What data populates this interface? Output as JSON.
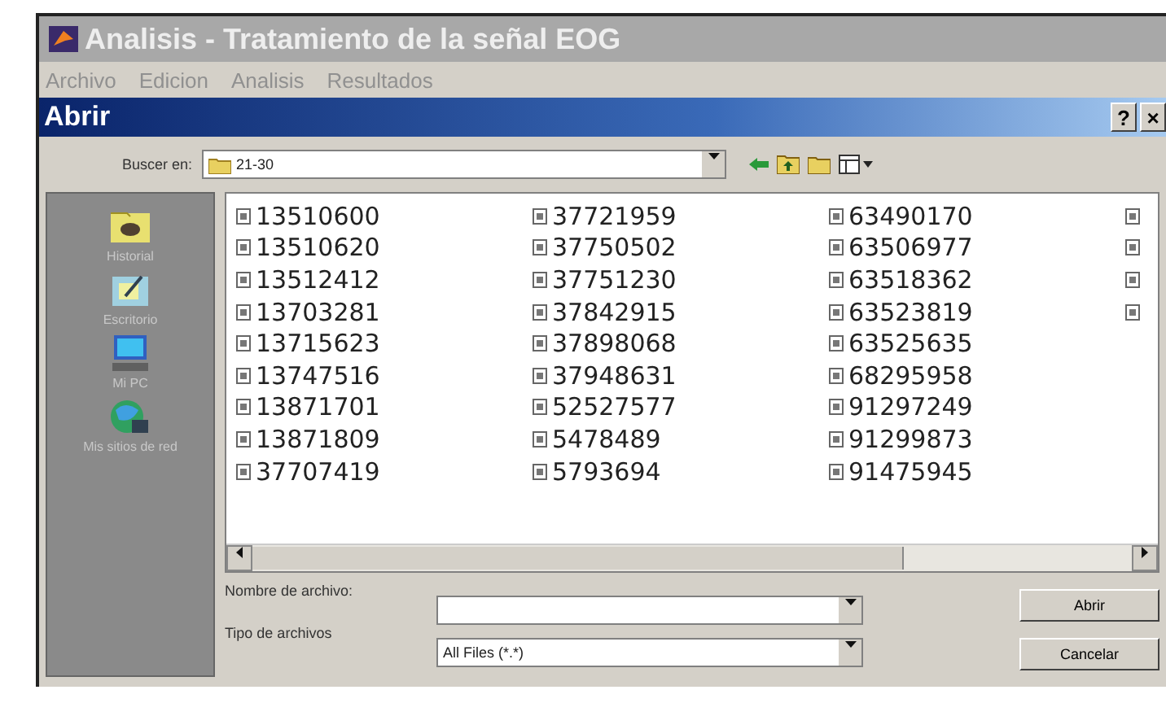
{
  "window": {
    "title": "Analisis - Tratamiento de la señal EOG"
  },
  "menu": [
    "Archivo",
    "Edicion",
    "Analisis",
    "Resultados"
  ],
  "dialog": {
    "title": "Abrir",
    "title_buttons": [
      "?",
      "×"
    ],
    "look_in": {
      "label": "Buscer en:",
      "value": "21-30"
    },
    "places": [
      {
        "kind": "history",
        "label": "Historial"
      },
      {
        "kind": "desktop",
        "label": "Escritorio"
      },
      {
        "kind": "computer",
        "label": "Mi PC"
      },
      {
        "kind": "network",
        "label": "Mis sitios de red"
      }
    ],
    "file_columns": [
      [
        {
          "kind": "file",
          "name": "13510600"
        },
        {
          "kind": "file",
          "name": "13510620"
        },
        {
          "kind": "file",
          "name": "13512412"
        },
        {
          "kind": "file",
          "name": "13703281"
        },
        {
          "kind": "file",
          "name": "13715623"
        },
        {
          "kind": "file",
          "name": "13747516"
        },
        {
          "kind": "file",
          "name": "13871701"
        },
        {
          "kind": "file",
          "name": "13871809"
        },
        {
          "kind": "file",
          "name": "37707419"
        }
      ],
      [
        {
          "kind": "file",
          "name": "37721959"
        },
        {
          "kind": "file",
          "name": "37750502"
        },
        {
          "kind": "file",
          "name": "37751230"
        },
        {
          "kind": "file",
          "name": "37842915"
        },
        {
          "kind": "file",
          "name": "37898068"
        },
        {
          "kind": "file",
          "name": "37948631"
        },
        {
          "kind": "file",
          "name": "52527577"
        },
        {
          "kind": "file",
          "name": "5478489"
        },
        {
          "kind": "file",
          "name": "5793694"
        }
      ],
      [
        {
          "kind": "file",
          "name": "63490170"
        },
        {
          "kind": "file",
          "name": "63506977"
        },
        {
          "kind": "file",
          "name": "63518362"
        },
        {
          "kind": "file",
          "name": "63523819"
        },
        {
          "kind": "file",
          "name": "63525635"
        },
        {
          "kind": "file",
          "name": "68295958"
        },
        {
          "kind": "file",
          "name": "91297249"
        },
        {
          "kind": "file",
          "name": "91299873"
        },
        {
          "kind": "file",
          "name": "91475945"
        }
      ],
      [
        {
          "kind": "cut"
        },
        {
          "kind": "cut"
        },
        {
          "kind": "cut"
        },
        {
          "kind": "cut"
        }
      ]
    ],
    "file_name": {
      "label": "Nombre de archivo:"
    },
    "file_type": {
      "label": "Tipo de archivos",
      "value": "All Files (*.*)"
    },
    "buttons": [
      "Abrir",
      "Cancelar"
    ]
  }
}
